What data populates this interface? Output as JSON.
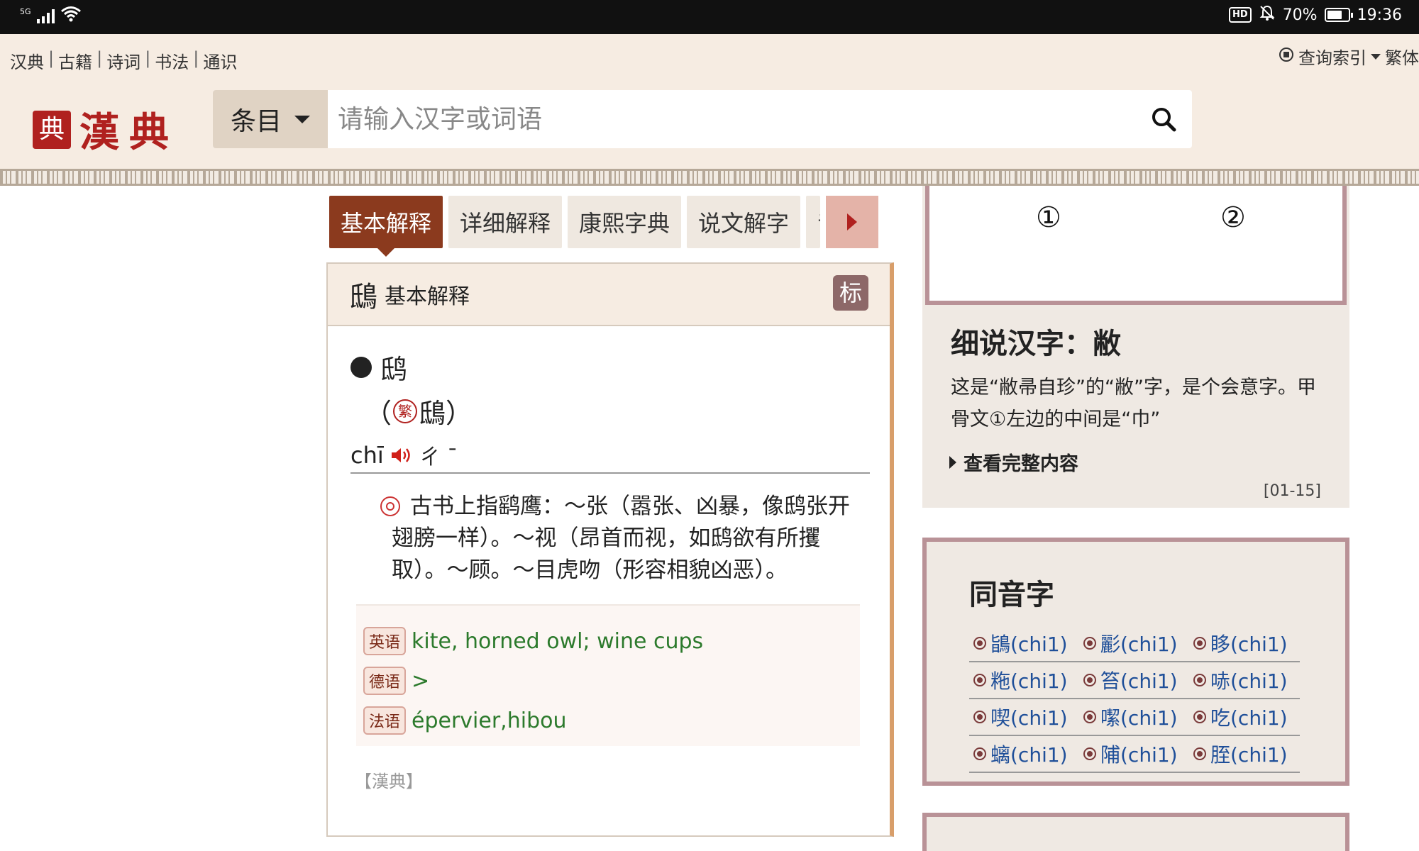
{
  "status_bar": {
    "network": "5G",
    "battery_percent": "70%",
    "battery_level": 0.7,
    "time": "19:36",
    "hd_label": "HD",
    "icons": [
      "signal-icon",
      "wifi-icon",
      "hd-icon",
      "mute-icon",
      "battery-icon"
    ]
  },
  "header": {
    "nav": [
      "汉典",
      "古籍",
      "诗词",
      "书法",
      "通识"
    ],
    "index_label": "查询索引",
    "traditional_label": "繁体",
    "logo_seal": "典",
    "logo_text": "漢典",
    "search": {
      "type_label": "条目",
      "placeholder": "请输入汉字或词语"
    }
  },
  "tabs": [
    "基本解释",
    "详细解释",
    "康熙字典",
    "说文解字",
    "音"
  ],
  "panel": {
    "char": "鴟",
    "title": "基本解释",
    "badge": "标",
    "entry_char": "鸱",
    "traditional_open": "（",
    "traditional_badge": "繁",
    "traditional_char": "鴟",
    "traditional_close": "）",
    "pinyin": "chī",
    "zhuyin": "ㄔ ˉ",
    "definition": "古书上指鹞鹰：～张（嚣张、凶暴，像鸱张开翅膀一样）。～视（昂首而视，如鸱欲有所攫取）。～顾。～目虎吻（形容相貌凶恶）。",
    "translations": [
      {
        "label": "英语",
        "value": "kite, horned owl; wine cups"
      },
      {
        "label": "德语",
        "value": ">"
      },
      {
        "label": "法语",
        "value": "épervier,hibou"
      }
    ],
    "source": "【漢典】"
  },
  "sidebar": {
    "glyph_marks": [
      "①",
      "②"
    ],
    "article_title": "细说汉字：敝",
    "article_text": "这是“敝帚自珍”的“敝”字，是个会意字。甲骨文①左边的中间是“巾”",
    "more_label": "查看完整内容",
    "date": "[01-15]",
    "homophones_title": "同音字",
    "homophones": [
      [
        "鴲(chi1)",
        "彲(chi1)",
        "眵(chi1)"
      ],
      [
        "粚(chi1)",
        "笞(chi1)",
        "哧(chi1)"
      ],
      [
        "喫(chi1)",
        "噄(chi1)",
        "吃(chi1)"
      ],
      [
        "螭(chi1)",
        "陠(chi1)",
        "胵(chi1)"
      ]
    ]
  }
}
